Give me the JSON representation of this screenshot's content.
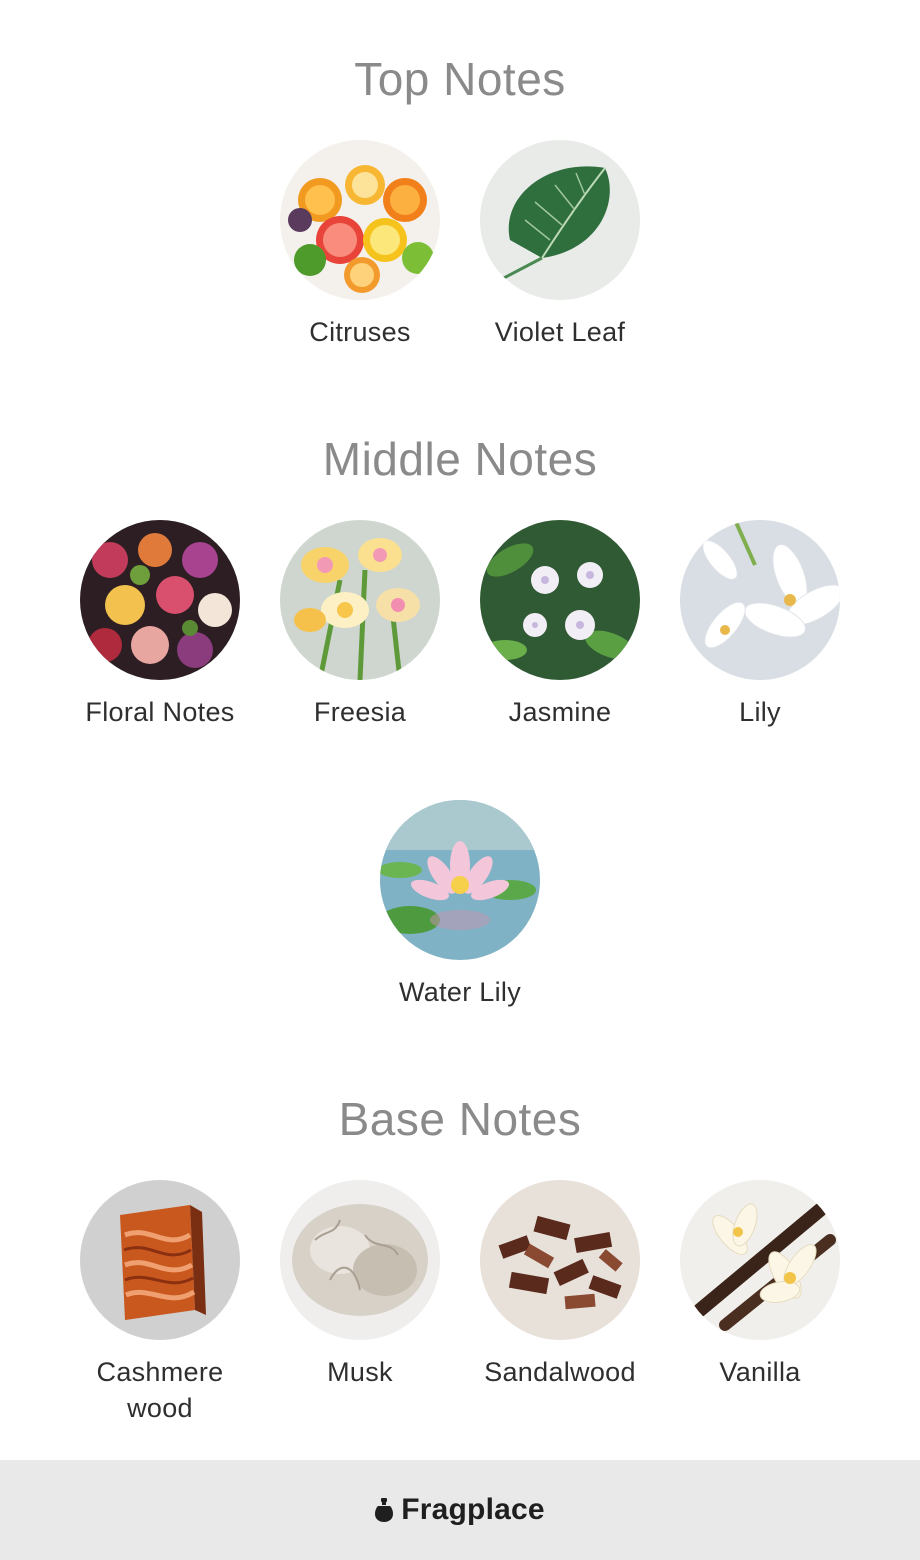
{
  "sections": {
    "top": {
      "title": "Top Notes",
      "notes": [
        {
          "label": "Citruses",
          "icon": "citrus-icon"
        },
        {
          "label": "Violet Leaf",
          "icon": "leaf-icon"
        }
      ]
    },
    "middle": {
      "title": "Middle Notes",
      "notes": [
        {
          "label": "Floral Notes",
          "icon": "bouquet-icon"
        },
        {
          "label": "Freesia",
          "icon": "freesia-icon"
        },
        {
          "label": "Jasmine",
          "icon": "jasmine-icon"
        },
        {
          "label": "Lily",
          "icon": "lily-icon"
        },
        {
          "label": "Water Lily",
          "icon": "water-lily-icon"
        }
      ]
    },
    "base": {
      "title": "Base Notes",
      "notes": [
        {
          "label": "Cashmere wood",
          "line1": "Cashmere",
          "line2": "wood",
          "icon": "wood-block-icon"
        },
        {
          "label": "Musk",
          "icon": "fur-icon"
        },
        {
          "label": "Sandalwood",
          "icon": "wood-chips-icon"
        },
        {
          "label": "Vanilla",
          "icon": "vanilla-pod-icon"
        }
      ]
    }
  },
  "footer": {
    "brand": "Fragplace",
    "logo_icon": "fragplace-logo-icon",
    "background": "#e9e9e9"
  },
  "colors": {
    "section_title": "#8a8a8a",
    "label": "#2f2f2f"
  }
}
